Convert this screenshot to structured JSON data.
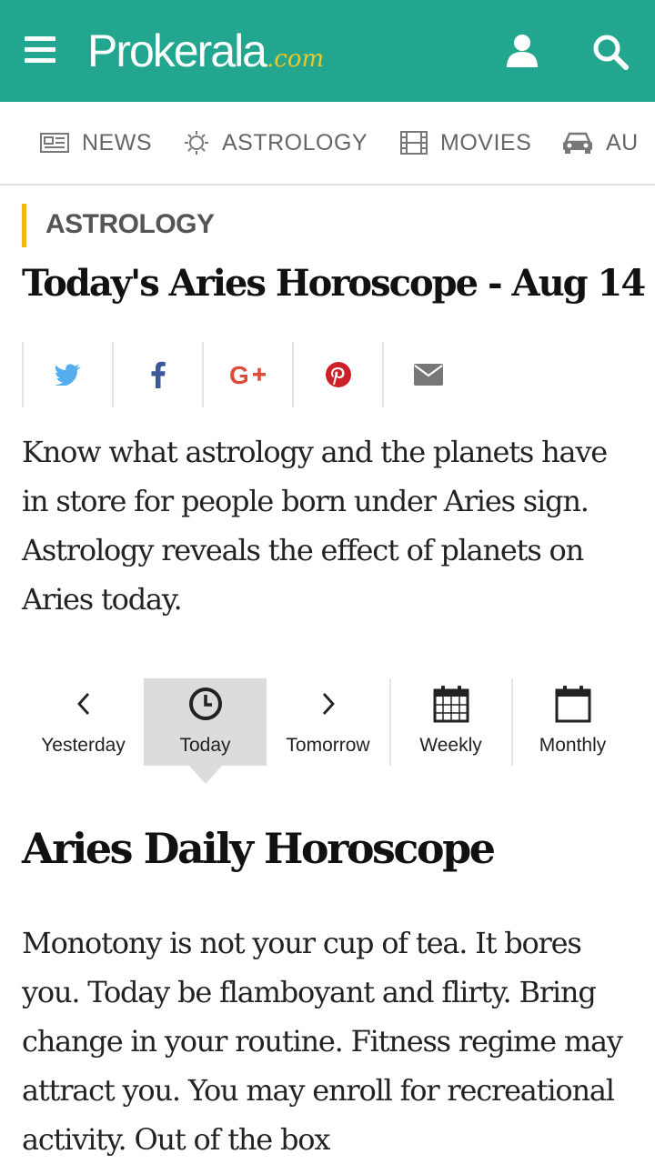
{
  "header": {
    "logo_text": "Prokerala",
    "logo_domain": ".com",
    "brand_color": "#22a68f",
    "accent_color": "#f3b51b"
  },
  "nav": {
    "items": [
      {
        "label": "NEWS",
        "icon": "newspaper-icon"
      },
      {
        "label": "ASTROLOGY",
        "icon": "sun-icon"
      },
      {
        "label": "MOVIES",
        "icon": "film-icon"
      },
      {
        "label": "AU",
        "icon": "car-icon"
      }
    ]
  },
  "article": {
    "section": "ASTROLOGY",
    "title": "Today's Aries Horoscope - Aug 14",
    "intro": "Know what astrology and the planets have in store for people born under Aries sign. Astrology reveals the effect of planets on Aries today.",
    "share": [
      {
        "name": "twitter-icon",
        "color": "#55acee"
      },
      {
        "name": "facebook-icon",
        "color": "#3b5998"
      },
      {
        "name": "google-plus-icon",
        "color": "#dd4b39"
      },
      {
        "name": "pinterest-icon",
        "color": "#cb2027"
      },
      {
        "name": "email-icon",
        "color": "#777777"
      }
    ]
  },
  "tabs": {
    "items": [
      {
        "label": "Yesterday",
        "icon": "chevron-left-icon"
      },
      {
        "label": "Today",
        "icon": "clock-icon",
        "active": true
      },
      {
        "label": "Tomorrow",
        "icon": "chevron-right-icon"
      },
      {
        "label": "Weekly",
        "icon": "calendar-grid-icon"
      },
      {
        "label": "Monthly",
        "icon": "calendar-icon"
      }
    ]
  },
  "horoscope": {
    "heading": "Aries Daily Horoscope",
    "text": "Monotony is not your cup of tea. It bores you. Today be flamboyant and flirty. Bring change in your routine. Fitness regime may attract you. You may enroll for recreational activity. Out of the box"
  }
}
